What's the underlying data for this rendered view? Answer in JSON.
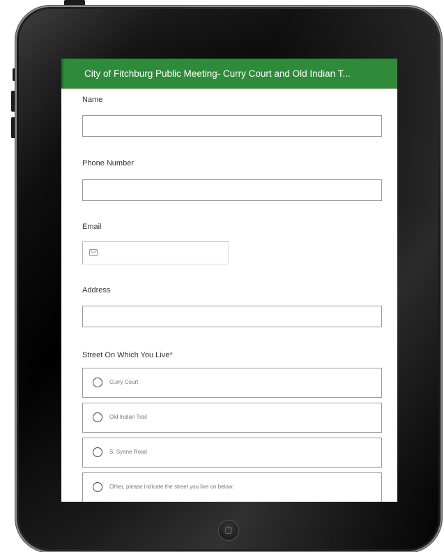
{
  "form": {
    "title": "City of Fitchburg Public Meeting- Curry Court and Old Indian T...",
    "fields": {
      "name": {
        "label": "Name",
        "value": ""
      },
      "phone": {
        "label": "Phone Number",
        "value": ""
      },
      "email": {
        "label": "Email",
        "value": "",
        "icon": "envelope-icon"
      },
      "address": {
        "label": "Address",
        "value": ""
      }
    },
    "street": {
      "label": "Street On Which You Live",
      "required_mark": "*",
      "options": [
        {
          "label": "Curry Court"
        },
        {
          "label": "Old Indian Trail"
        },
        {
          "label": "S. Syene Road"
        },
        {
          "label": "Other, please indicate the street you live on below."
        }
      ]
    }
  },
  "colors": {
    "header_green": "#2e8b3a",
    "required": "#cc2222"
  },
  "device": {
    "home_button_icon": "home-button-icon"
  }
}
